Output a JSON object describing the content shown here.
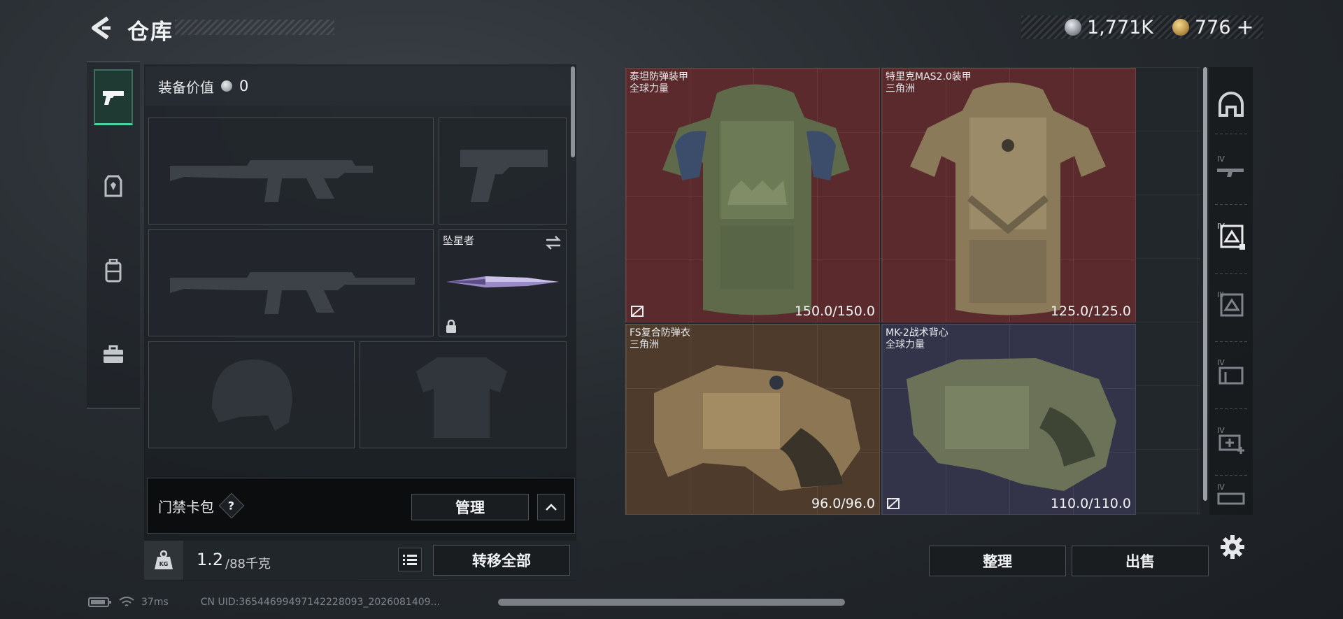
{
  "header": {
    "title": "仓库",
    "currencies": [
      {
        "icon": "silver-coin-icon",
        "value": "1,771K"
      },
      {
        "icon": "gold-coin-icon",
        "value": "776"
      }
    ],
    "add_label": "+"
  },
  "left_tabs": [
    {
      "icon": "pistol-icon",
      "active": true
    },
    {
      "icon": "armor-vest-icon",
      "active": false
    },
    {
      "icon": "backpack-icon",
      "active": false
    },
    {
      "icon": "toolbox-icon",
      "active": false
    }
  ],
  "loadout": {
    "equip_value_label": "装备价值",
    "equip_value": "0",
    "melee_slot": {
      "name": "坠星者"
    },
    "keycard": {
      "label": "门禁卡包",
      "help": "?",
      "manage_label": "管理"
    },
    "weight": {
      "current": "1.2",
      "max": "/88千克",
      "kg_badge": "KG"
    },
    "transfer_all_label": "转移全部"
  },
  "storage_items": [
    {
      "name": "泰坦防弹装甲",
      "faction": "全球力量",
      "durability": "150.0/150.0",
      "bg": "#5b2a2c"
    },
    {
      "name": "特里克MAS2.0装甲",
      "faction": "三角洲",
      "durability": "125.0/125.0",
      "bg": "#5b2a2c"
    },
    {
      "name": "FS复合防弹衣",
      "faction": "三角洲",
      "durability": "96.0/96.0",
      "bg": "#4f3b2c"
    },
    {
      "name": "MK-2战术背心",
      "faction": "全球力量",
      "durability": "110.0/110.0",
      "bg": "#33344a"
    }
  ],
  "right_rail": [
    {
      "icon": "helmet-category-icon",
      "tier": ""
    },
    {
      "icon": "rifle-iv-icon",
      "tier": "IV"
    },
    {
      "icon": "armor-iv-icon",
      "tier": "IV"
    },
    {
      "icon": "armor-iii-icon",
      "tier": "III"
    },
    {
      "icon": "container-iv-icon",
      "tier": "IV"
    },
    {
      "icon": "medkit-iv-icon",
      "tier": "IV"
    },
    {
      "icon": "vehicle-iv-icon",
      "tier": "IV"
    }
  ],
  "actions": {
    "sort_label": "整理",
    "sell_label": "出售"
  },
  "status": {
    "ping": "37ms",
    "uid": "CN UID:36544699497142228093_2026081409..."
  },
  "colors": {
    "accent": "#49d3a3",
    "red_rarity": "#5b2a2c",
    "gold_rarity": "#4f3b2c",
    "purple_rarity": "#33344a"
  }
}
